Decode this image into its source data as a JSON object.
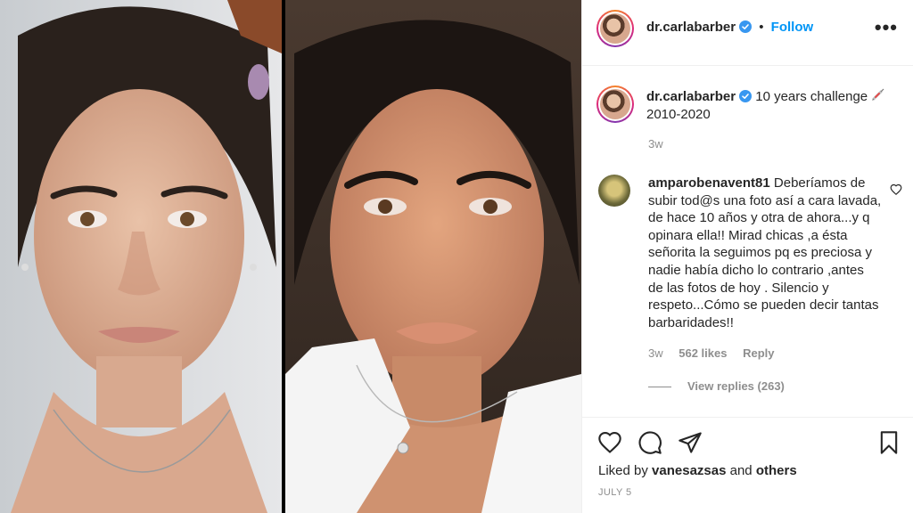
{
  "post": {
    "username": "dr.carlabarber",
    "follow_label": "Follow",
    "separator": "•",
    "more_label": "•••",
    "caption_text": "10 years challenge",
    "caption_years": "2010-2020",
    "caption_time": "3w"
  },
  "comment": {
    "username": "amparobenavent81",
    "text": "Deberíamos de subir tod@s una foto así a cara lavada, de hace 10 años y otra de ahora...y q opinara ella!! Mirad chicas ,a ésta señorita la seguimos pq es preciosa y nadie había dicho lo contrario ,antes de las fotos de hoy . Silencio y respeto...Cómo se pueden decir tantas barbaridades!!",
    "time": "3w",
    "likes": "562 likes",
    "reply_label": "Reply",
    "view_replies": "View replies (263)"
  },
  "footer": {
    "liked_by_prefix": "Liked by",
    "liked_by_user": "vanesazsas",
    "liked_by_and": "and",
    "liked_by_others": "others",
    "date": "JULY 5"
  },
  "icons": {
    "verified": "verified-badge-icon",
    "like": "heart-icon",
    "comment": "comment-bubble-icon",
    "share": "paper-plane-icon",
    "save": "bookmark-icon",
    "caption_emoji": "syringe-icon"
  },
  "colors": {
    "link_blue": "#0095f6",
    "secondary_text": "#8e8e8e",
    "primary_text": "#262626",
    "border": "#efefef"
  }
}
